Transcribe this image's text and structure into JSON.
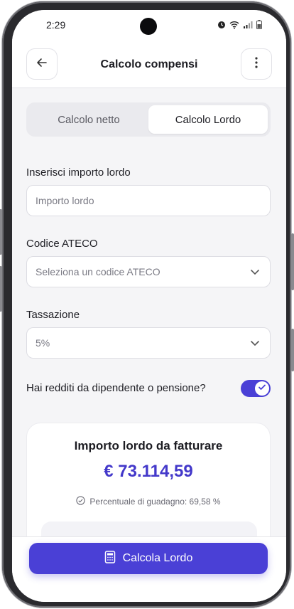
{
  "status": {
    "time": "2:29"
  },
  "header": {
    "title": "Calcolo compensi"
  },
  "tabs": [
    {
      "label": "Calcolo netto",
      "active": false
    },
    {
      "label": "Calcolo Lordo",
      "active": true
    }
  ],
  "form": {
    "gross_label": "Inserisci importo lordo",
    "gross_placeholder": "Importo lordo",
    "ateco_label": "Codice ATECO",
    "ateco_placeholder": "Seleziona un codice ATECO",
    "tax_label": "Tassazione",
    "tax_value": "5%",
    "toggle_label": "Hai redditi da dipendente o pensione?",
    "toggle_on": true
  },
  "result": {
    "title": "Importo lordo da fatturare",
    "amount": "€ 73.114,59",
    "percentage": "Percentuale di guadagno: 69,58 %"
  },
  "cta": {
    "label": "Calcola Lordo"
  },
  "colors": {
    "accent": "#4a40d6",
    "amount": "#4338ca"
  }
}
